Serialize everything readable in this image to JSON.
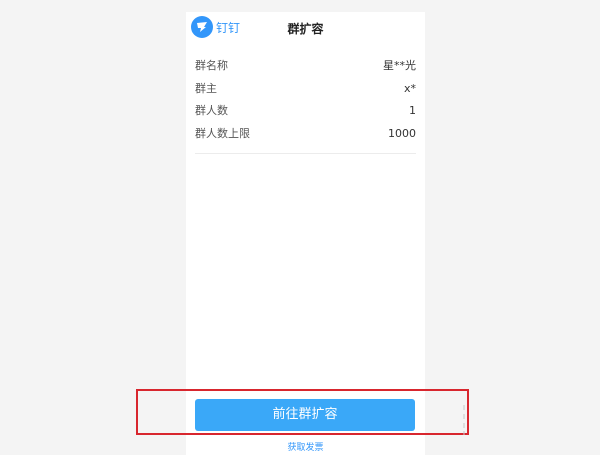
{
  "header": {
    "brand": "钉钉",
    "title": "群扩容"
  },
  "group_info": [
    {
      "label": "群名称",
      "value": "星**光"
    },
    {
      "label": "群主",
      "value": "x*"
    },
    {
      "label": "群人数",
      "value": "1"
    },
    {
      "label": "群人数上限",
      "value": "1000"
    }
  ],
  "actions": {
    "expand_button": "前往群扩容",
    "invoice_link": "获取发票"
  },
  "colors": {
    "accent": "#3296fa",
    "button": "#3aa8f8",
    "highlight": "#d8262e"
  },
  "icons": {
    "logo": "dingtalk-logo-icon"
  }
}
